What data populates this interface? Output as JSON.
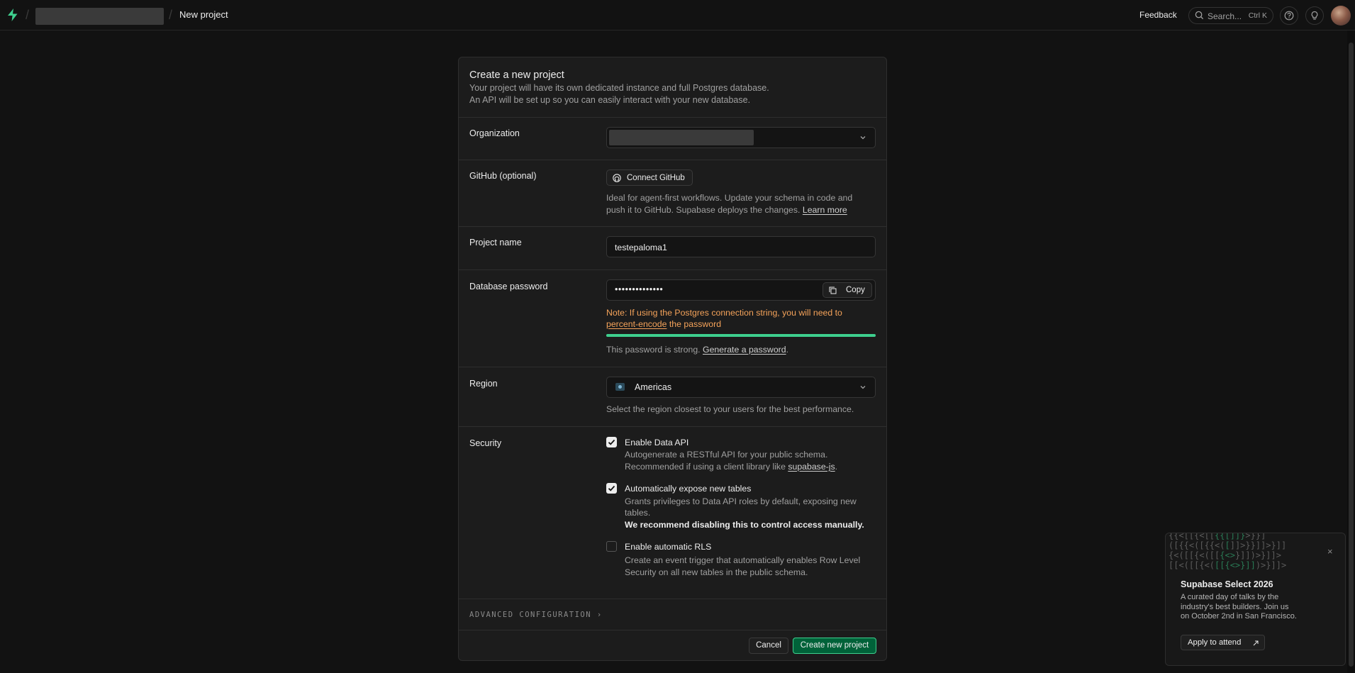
{
  "topbar": {
    "org_name": "",
    "breadcrumb_page": "New project",
    "feedback_label": "Feedback",
    "search_placeholder": "Search...",
    "search_shortcut": "Ctrl K",
    "icons": [
      "supabase-logo-icon",
      "search-icon",
      "help-icon",
      "lightbulb-icon"
    ]
  },
  "form": {
    "title": "Create a new project",
    "description_line1": "Your project will have its own dedicated instance and full Postgres database.",
    "description_line2": "An API will be set up so you can easily interact with your new database.",
    "organization": {
      "label": "Organization",
      "value": ""
    },
    "github": {
      "label": "GitHub (optional)",
      "button": "Connect GitHub",
      "help_line1": "Ideal for agent-first workflows. Update your schema in code and",
      "help_line2": "push it to GitHub. Supabase deploys the changes.",
      "learn_more": "Learn more"
    },
    "project_name": {
      "label": "Project name",
      "value": "testepaloma1"
    },
    "database_password": {
      "label": "Database password",
      "value": "••••••••••••••",
      "copy_label": "Copy",
      "note_line1": "Note: If using the Postgres connection string, you will need to",
      "note_link": "percent-encode",
      "note_line2_rest": "the password",
      "strength_fraction": 1.0,
      "strength_color": "#3ecf8e",
      "strength_text": "This password is strong.",
      "generate_link": "Generate a password",
      "generate_suffix": "."
    },
    "region": {
      "label": "Region",
      "value": "Americas",
      "help": "Select the region closest to your users for the best performance."
    },
    "security": {
      "label": "Security",
      "options": [
        {
          "label": "Enable Data API",
          "checked": true,
          "desc1": "Autogenerate a RESTful API for your public schema.",
          "desc2_pre": "Recommended if using a client library like ",
          "desc2_link": "supabase-js",
          "desc2_post": "."
        },
        {
          "label": "Automatically expose new tables",
          "checked": true,
          "desc1": "Grants privileges to Data API roles by default, exposing new",
          "desc2": "tables.",
          "desc3_bold": "We recommend disabling this to control access manually."
        },
        {
          "label": "Enable automatic RLS",
          "checked": false,
          "desc1": "Create an event trigger that automatically enables Row Level",
          "desc2": "Security on all new tables in the public schema."
        }
      ]
    },
    "advanced_label": "ADVANCED CONFIGURATION",
    "cancel_label": "Cancel",
    "create_label": "Create new project"
  },
  "promo": {
    "title": "Supabase Select 2026",
    "desc_line1": "A curated day of talks by the",
    "desc_line2": "industry's best builders. Join us",
    "desc_line3": "on October 2nd in San Francisco.",
    "button": "Apply to attend",
    "close": "×"
  },
  "colors": {
    "accent": "#3ecf8e",
    "primary_button": "#006239",
    "warning": "#f5a35a"
  }
}
